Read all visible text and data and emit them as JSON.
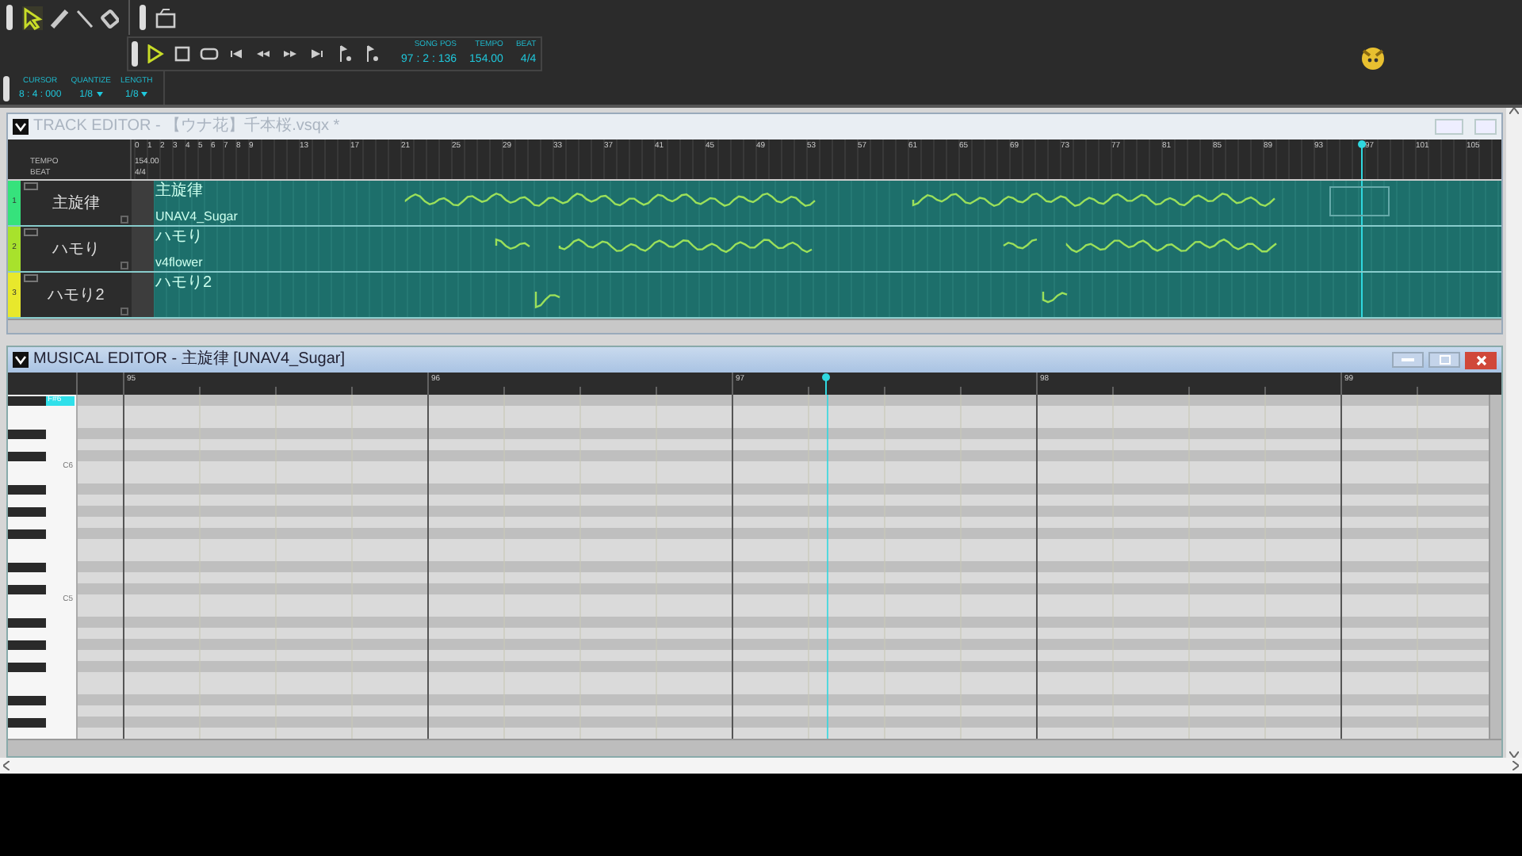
{
  "toolbar": {
    "tools": [
      {
        "kind": "pointer",
        "selected": true
      },
      {
        "kind": "pencil",
        "selected": false
      },
      {
        "kind": "line",
        "selected": false
      },
      {
        "kind": "eraser",
        "selected": false
      }
    ],
    "readouts": [
      {
        "label": "SONG POS",
        "value": "97 : 2 : 136"
      },
      {
        "label": "TEMPO",
        "value": "154.00"
      },
      {
        "label": "BEAT",
        "value": "4/4"
      }
    ],
    "settings": [
      {
        "kind": "readout",
        "label": "CURSOR",
        "value": "8 : 4 : 000"
      },
      {
        "kind": "dropdown",
        "label": "QUANTIZE",
        "value": "1/8"
      },
      {
        "kind": "dropdown",
        "label": "LENGTH",
        "value": "1/8"
      }
    ]
  },
  "track_editor": {
    "title": "TRACK EDITOR - 【ウナ花】千本桜.vsqx *",
    "ruler_labels": [
      "0",
      "1",
      "2",
      "3",
      "4",
      "5",
      "6",
      "7",
      "8",
      "9",
      "13",
      "17",
      "21",
      "25",
      "29",
      "33",
      "37",
      "41",
      "45",
      "49",
      "53",
      "57",
      "61",
      "65",
      "69",
      "73",
      "77",
      "81",
      "85",
      "89",
      "93",
      "97",
      "101",
      "105"
    ],
    "tempo_label": "TEMPO",
    "tempo_value": "154.00",
    "beat_label": "BEAT",
    "beat_value": "4/4",
    "tracks": [
      {
        "number": "1",
        "name": "主旋律",
        "color": "#36e27c",
        "part_labels": [
          "主旋律",
          "UNAV4_Sugar"
        ]
      },
      {
        "number": "2",
        "name": "ハモり",
        "color": "#a8e22c",
        "part_labels": [
          "ハモり",
          "v4flower"
        ]
      },
      {
        "number": "3",
        "name": "ハモり2",
        "color": "#e8e82c",
        "part_labels": [
          "ハモり2"
        ]
      }
    ]
  },
  "musical_editor": {
    "title": "MUSICAL EDITOR - 主旋律 [UNAV4_Sugar]",
    "measure_labels": [
      "95",
      "96",
      "97",
      "98",
      "99"
    ],
    "keys": [
      {
        "label": "F#6",
        "selected": true
      },
      {
        "label": "C6",
        "selected": false
      },
      {
        "label": "C5",
        "selected": false
      }
    ]
  }
}
